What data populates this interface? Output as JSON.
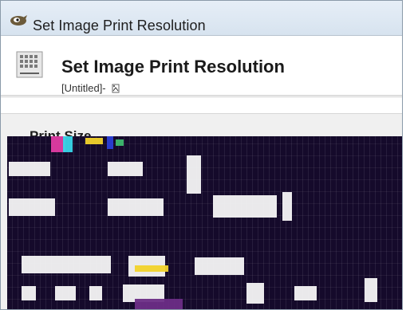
{
  "window": {
    "title": "Set Image Print Resolution"
  },
  "header": {
    "title": "Set Image Print Resolution",
    "subtitle": "[Untitled]-"
  },
  "sections": {
    "print_size_label": "Print Size"
  },
  "icons": {
    "app": "gimp-icon",
    "header": "print-resolution-icon",
    "thumbnail": "image-thumbnail-icon"
  },
  "colors": {
    "titlebar": "#dfe8f2",
    "background": "#f0f0f0",
    "header": "#ffffff",
    "glitch": "#150a2b"
  }
}
